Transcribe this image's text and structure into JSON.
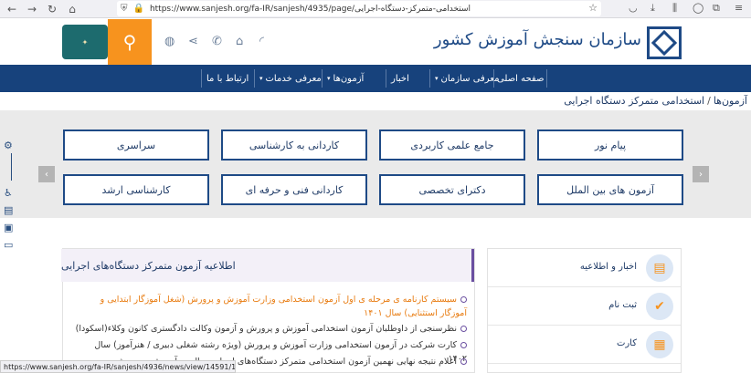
{
  "browser": {
    "url": "https://www.sanjesh.org/fa-IR/sanjesh/4935/page/استخدامی-متمرکز-دستگاه-اجرایی"
  },
  "header": {
    "org_name": "سازمان سنجش آموزش کشور"
  },
  "navbar": {
    "items": [
      {
        "label": "صفحه اصلی"
      },
      {
        "label": "معرفی سازمان"
      },
      {
        "label": "اخبار"
      },
      {
        "label": "آزمون‌ها"
      },
      {
        "label": "معرفی خدمات"
      },
      {
        "label": "ارتباط با ما"
      }
    ]
  },
  "breadcrumb": {
    "root": "آزمون‌ها",
    "separator": "/",
    "current": "استخدامی متمرکز دستگاه اجرایی"
  },
  "categories": [
    {
      "label": "پیام نور"
    },
    {
      "label": "جامع علمی کاربردی"
    },
    {
      "label": "کاردانی به کارشناسی"
    },
    {
      "label": "سراسری"
    },
    {
      "label": "آزمون های بین الملل"
    },
    {
      "label": "دکترای تخصصی"
    },
    {
      "label": "کاردانی فنی و حرفه ای"
    },
    {
      "label": "کارشناسی ارشد"
    }
  ],
  "news": {
    "title": "اطلاعیه آزمون متمرکز دستگاه‌های اجرایی",
    "items": [
      {
        "text": "سیستم کارنامه ی مرحله ی اول آزمون استخدامی وزارت آموزش و پرورش (شغل آموزگار ابتدایی و آموزگار استثنایی) سال ۱۴۰۱"
      },
      {
        "text": "نظرسنجی از داوطلبان آزمون استخدامی آموزش و پرورش و آزمون وکالت دادگستری کانون وکلاء(اسکودا)"
      },
      {
        "text": "کارت شرکت در آزمون استخدامی وزارت آموزش و پرورش (ویژه رشته شغلی دبیری / هنرآموز) سال ۱۴۰۲"
      },
      {
        "text": "اعلام نتیجه نهایی نهمین آزمون استخدامی متمرکز دستگاه‌های اجرایی سال ... آموزش و پرورش"
      }
    ]
  },
  "services": [
    {
      "label": "اخبار و اطلاعیه"
    },
    {
      "label": "ثبت نام"
    },
    {
      "label": "کارت"
    }
  ],
  "status_bar": {
    "text": "https://www.sanjesh.org/fa-IR/sanjesh/4936/news/view/14591/10701/Staging"
  }
}
